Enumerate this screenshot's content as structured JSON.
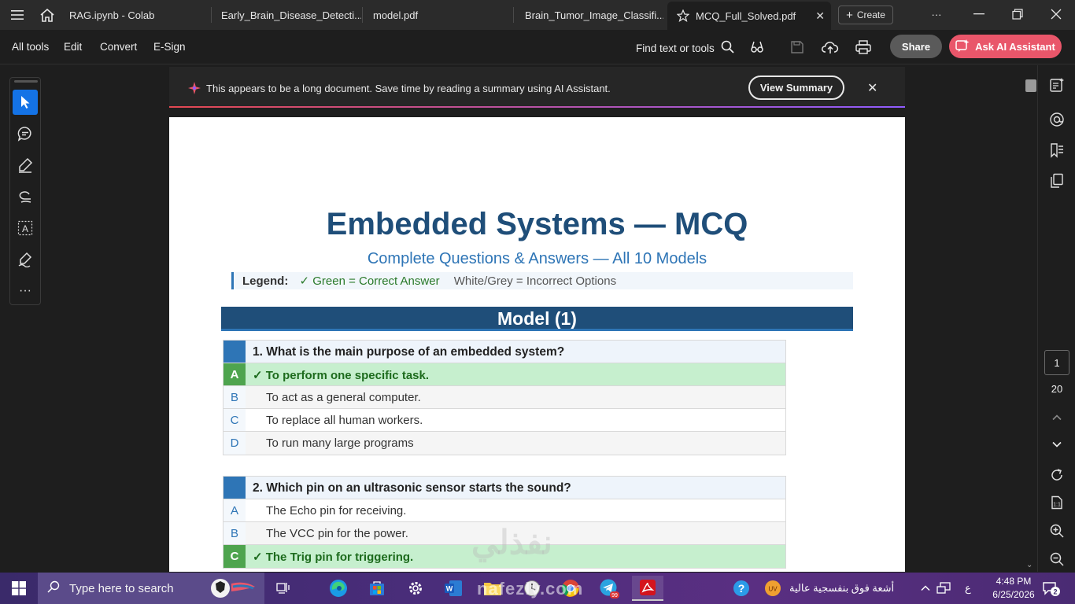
{
  "browser": {
    "tabs": [
      {
        "label": "RAG.ipynb - Colab"
      },
      {
        "label": "Early_Brain_Disease_Detecti..."
      },
      {
        "label": "model.pdf"
      },
      {
        "label": "Brain_Tumor_Image_Classifi..."
      },
      {
        "label": "MCQ_Full_Solved.pdf",
        "active": true
      }
    ],
    "create_label": "Create"
  },
  "toolbar": {
    "menu": [
      "All tools",
      "Edit",
      "Convert",
      "E-Sign"
    ],
    "find_label": "Find text or tools",
    "share_label": "Share",
    "ai_label": "Ask AI Assistant"
  },
  "banner": {
    "text": "This appears to be a long document. Save time by reading a summary using AI Assistant.",
    "button": "View Summary"
  },
  "document": {
    "title": "Embedded Systems — MCQ",
    "subtitle": "Complete Questions & Answers — All 10 Models",
    "legend_label": "Legend:",
    "legend_correct": "✓ Green = Correct Answer",
    "legend_incorrect": "White/Grey = Incorrect Options",
    "model_title": "Model (1)",
    "questions": [
      {
        "text": "1. What is the main purpose of an embedded system?",
        "options": [
          {
            "letter": "A",
            "text": "✓ To perform one specific task.",
            "correct": true
          },
          {
            "letter": "B",
            "text": "To act as a general computer."
          },
          {
            "letter": "C",
            "text": "To replace all human workers."
          },
          {
            "letter": "D",
            "text": "To run many large programs"
          }
        ]
      },
      {
        "text": "2. Which pin on an ultrasonic sensor starts the sound?",
        "options": [
          {
            "letter": "A",
            "text": "The Echo pin for receiving."
          },
          {
            "letter": "B",
            "text": "The VCC pin for the power."
          },
          {
            "letter": "C",
            "text": "✓ The Trig pin for triggering.",
            "correct": true
          }
        ]
      }
    ],
    "watermark": "نفذلي"
  },
  "navigation": {
    "current_page": "1",
    "total_pages": "20"
  },
  "taskbar": {
    "search_placeholder": "Type here to search",
    "weather_text": "أشعة فوق بنفسجية عالية",
    "weather_badge": "UV",
    "lang": "ع",
    "time": "4:48 PM",
    "date": "6/25/2026",
    "notifications": "2",
    "telegram_badge": "99",
    "watermark": "nafezly.com"
  },
  "colors": {
    "accent": "#1473e6",
    "ai_button": "#e9566a",
    "heading": "#1f4e79",
    "subheading": "#2e75b6",
    "correct_bg": "#c6efce",
    "correct_text": "#1d6b1d"
  }
}
